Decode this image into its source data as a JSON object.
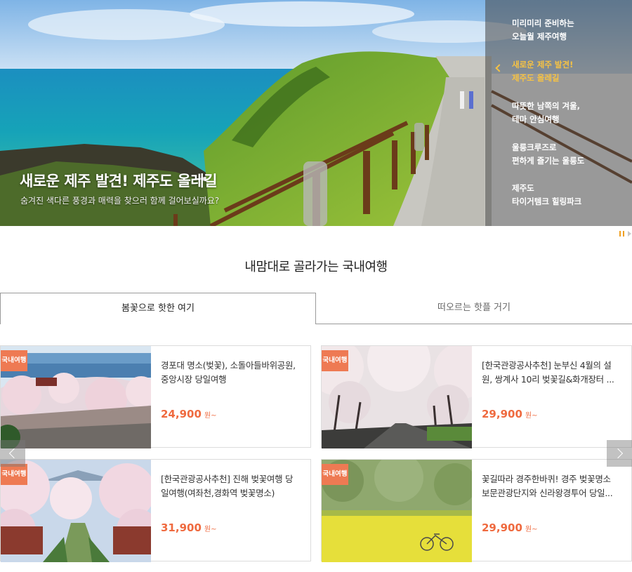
{
  "hero": {
    "title": "새로운 제주 발견! 제주도 올레길",
    "subtitle": "숨겨진 색다른 풍경과 매력을 찾으러 함께 걸어보실까요?",
    "menu": [
      {
        "line1": "미리미리 준비하는",
        "line2": "오늘월 제주여행",
        "active": false
      },
      {
        "line1": "새로운 제주 발견!",
        "line2": "제주도 올레길",
        "active": true
      },
      {
        "line1": "따뜻한 남쪽의 겨울,",
        "line2": "테마 안심여행",
        "active": false
      },
      {
        "line1": "울릉크루즈로",
        "line2": "편하게 즐기는 울릉도",
        "active": false
      },
      {
        "line1": "제주도",
        "line2": "타이거템크 힐링파크",
        "active": false
      }
    ]
  },
  "section": {
    "title": "내맘대로 골라가는 국내여행",
    "tabs": [
      "봄꽃으로 핫한 여기",
      "떠오르는 핫플 거기"
    ]
  },
  "cards": [
    {
      "badge": "국내여행",
      "line1": "경포대 명소(벚꽃), 소돌아들바위공원,",
      "line2": "중앙시장 당일여행",
      "price": "24,900",
      "unit": "원~"
    },
    {
      "badge": "국내여행",
      "line1": "[한국관광공사추천] 눈부신 4월의 설",
      "line2": "원, 쌍계사 10리 벚꽃길&화개장터 ...",
      "price": "29,900",
      "unit": "원~"
    },
    {
      "badge": "국내여행",
      "line1": "[한국관광공사추천] 진해 벚꽃여행 당",
      "line2": "일여행(여좌천,경화역 벚꽃명소)",
      "price": "31,900",
      "unit": "원~"
    },
    {
      "badge": "국내여행",
      "line1": "꽃길따라 경주한바퀴! 경주 벚꽃명소",
      "line2": "보문관광단지와 신라왕경투어 당일...",
      "price": "29,900",
      "unit": "원~"
    }
  ]
}
